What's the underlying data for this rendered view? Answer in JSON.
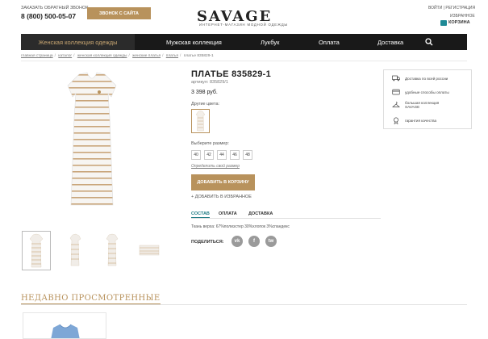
{
  "header": {
    "callback_label": "ЗАКАЗАТЬ ОБРАТНЫЙ ЗВОНОК",
    "phone": "8 (800) 500-05-07",
    "callback_button": "ЗВОНОК С САЙТА",
    "logo": "SAVAGE",
    "tagline": "ИНТЕРНЕТ-МАГАЗИН МОДНОЙ ОДЕЖДЫ",
    "auth": "ВОЙТИ | РЕГИСТРАЦИЯ",
    "wishlist": "ИЗБРАННОЕ",
    "cart": "КОРЗИНА"
  },
  "nav": {
    "items": [
      "Женская коллекция одежды",
      "Мужская коллекция",
      "Лукбук",
      "Оплата",
      "Доставка"
    ],
    "search_icon": "search-icon"
  },
  "breadcrumb": [
    "главная страница",
    "каталог",
    "женская коллекция одежды",
    "женские платья",
    "платья",
    "платье 835829-1"
  ],
  "product": {
    "title": "ПЛАТЬЕ 835829-1",
    "sku": "артикул: 835829/1",
    "price": "3 398 руб.",
    "other_colors_label": "Другие цвета:",
    "size_label": "Выберите размер:",
    "sizes": [
      "40",
      "42",
      "44",
      "46",
      "48"
    ],
    "size_guide": "Определить свой размер",
    "add_to_cart": "ДОБАВИТЬ В КОРЗИНУ",
    "add_to_fav": "+ ДОБАВИТЬ В ИЗБРАННОЕ",
    "tabs": [
      "СОСТАВ",
      "ОПЛАТА",
      "ДОСТАВКА"
    ],
    "active_tab": "СОСТАВ",
    "composition": "Ткань верха: 67%полиэстер 30%хлопок 3%спандекс",
    "share_label": "ПОДЕЛИТЬСЯ:",
    "social": [
      "vk",
      "f",
      "tw"
    ],
    "social_icons": [
      "vk-icon",
      "facebook-icon",
      "twitter-icon"
    ]
  },
  "features": [
    {
      "icon": "truck-icon",
      "text": "Доставка по всей россии"
    },
    {
      "icon": "card-icon",
      "text": "удобные способы оплаты"
    },
    {
      "icon": "hanger-icon",
      "text": "большая коллекция SAVAGE"
    },
    {
      "icon": "medal-icon",
      "text": "гарантия качества"
    }
  ],
  "recent": {
    "title": "НЕДАВНО ПРОСМОТРЕННЫЕ"
  },
  "colors": {
    "accent": "#b8925c",
    "nav_bg": "#191919",
    "active_tab": "#1f7b84",
    "cart_icon": "#1f8a96"
  }
}
